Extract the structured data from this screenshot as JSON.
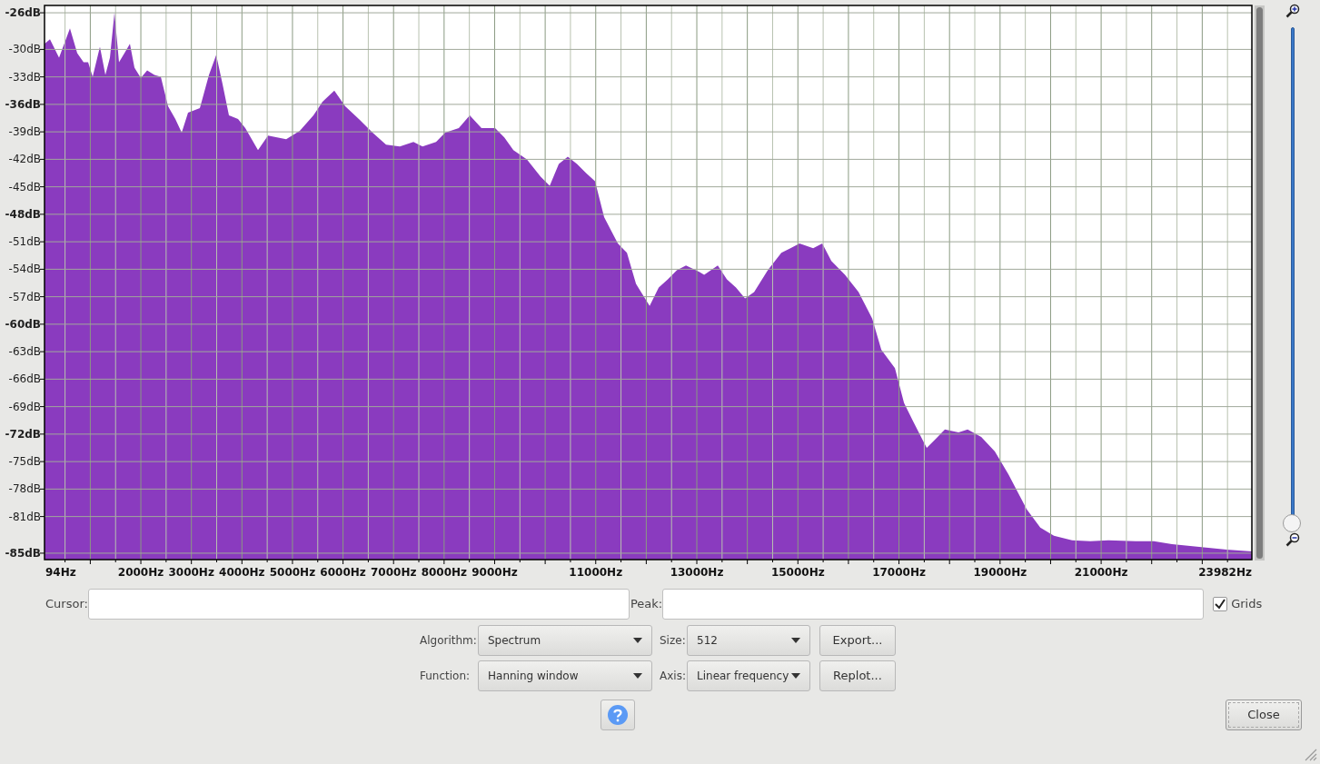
{
  "plot": {
    "chart_data": {
      "type": "area",
      "grid": true,
      "xlim": [
        94,
        23982
      ],
      "ylim": [
        -85.7,
        -25.2
      ],
      "xticks": [
        {
          "value": 94,
          "label": "94Hz"
        },
        {
          "value": 2000,
          "label": "2000Hz"
        },
        {
          "value": 3000,
          "label": "3000Hz"
        },
        {
          "value": 4000,
          "label": "4000Hz"
        },
        {
          "value": 5000,
          "label": "5000Hz"
        },
        {
          "value": 6000,
          "label": "6000Hz"
        },
        {
          "value": 7000,
          "label": "7000Hz"
        },
        {
          "value": 8000,
          "label": "8000Hz"
        },
        {
          "value": 9000,
          "label": "9000Hz"
        },
        {
          "value": 11000,
          "label": "11000Hz"
        },
        {
          "value": 13000,
          "label": "13000Hz"
        },
        {
          "value": 15000,
          "label": "15000Hz"
        },
        {
          "value": 17000,
          "label": "17000Hz"
        },
        {
          "value": 19000,
          "label": "19000Hz"
        },
        {
          "value": 21000,
          "label": "21000Hz"
        },
        {
          "value": 23982,
          "label": "23982Hz"
        }
      ],
      "yticks": [
        {
          "value": -26,
          "label": "-26dB"
        },
        {
          "value": -30,
          "label": "-30dB"
        },
        {
          "value": -33,
          "label": "-33dB"
        },
        {
          "value": -36,
          "label": "-36dB"
        },
        {
          "value": -39,
          "label": "-39dB"
        },
        {
          "value": -42,
          "label": "-42dB"
        },
        {
          "value": -45,
          "label": "-45dB"
        },
        {
          "value": -48,
          "label": "-48dB"
        },
        {
          "value": -51,
          "label": "-51dB"
        },
        {
          "value": -54,
          "label": "-54dB"
        },
        {
          "value": -57,
          "label": "-57dB"
        },
        {
          "value": -60,
          "label": "-60dB"
        },
        {
          "value": -63,
          "label": "-63dB"
        },
        {
          "value": -66,
          "label": "-66dB"
        },
        {
          "value": -69,
          "label": "-69dB"
        },
        {
          "value": -72,
          "label": "-72dB"
        },
        {
          "value": -75,
          "label": "-75dB"
        },
        {
          "value": -78,
          "label": "-78dB"
        },
        {
          "value": -81,
          "label": "-81dB"
        },
        {
          "value": -85,
          "label": "-85dB"
        }
      ],
      "x": [
        94,
        202,
        382,
        597,
        741,
        867,
        957,
        1047,
        1190,
        1298,
        1388,
        1478,
        1568,
        1676,
        1784,
        1874,
        2000,
        2125,
        2269,
        2395,
        2539,
        2683,
        2808,
        2934,
        3168,
        3347,
        3491,
        3617,
        3743,
        3923,
        4067,
        4318,
        4516,
        4696,
        4876,
        5145,
        5415,
        5595,
        5828,
        6044,
        6314,
        6584,
        6853,
        7123,
        7393,
        7573,
        7841,
        8021,
        8291,
        8507,
        8740,
        9010,
        9190,
        9370,
        9639,
        9909,
        10089,
        10269,
        10448,
        10628,
        10808,
        10987,
        11167,
        11437,
        11617,
        11797,
        12066,
        12246,
        12426,
        12605,
        12785,
        13055,
        13145,
        13414,
        13594,
        13774,
        13954,
        14133,
        14403,
        14673,
        14852,
        15032,
        15302,
        15482,
        15661,
        15931,
        16200,
        16470,
        16650,
        16920,
        17100,
        17279,
        17549,
        17729,
        17908,
        18178,
        18358,
        18627,
        18897,
        19167,
        19526,
        19796,
        20065,
        20425,
        20784,
        21144,
        21683,
        22043,
        22402,
        22941,
        23481,
        23982
      ],
      "series": [
        {
          "color": "#8a3bbf",
          "values": [
            -29.4,
            -28.9,
            -30.9,
            -27.7,
            -30.4,
            -31.4,
            -31.4,
            -33.0,
            -29.7,
            -32.8,
            -30.9,
            -26.0,
            -31.4,
            -30.4,
            -29.4,
            -32.0,
            -33.1,
            -32.3,
            -32.8,
            -33.0,
            -36.2,
            -37.6,
            -39.1,
            -36.9,
            -36.4,
            -32.8,
            -30.6,
            -33.8,
            -37.2,
            -37.6,
            -38.6,
            -41.0,
            -39.4,
            -39.6,
            -39.8,
            -38.9,
            -37.2,
            -35.7,
            -34.5,
            -36.2,
            -37.6,
            -39.1,
            -40.4,
            -40.6,
            -40.1,
            -40.6,
            -40.1,
            -39.1,
            -38.6,
            -37.2,
            -38.6,
            -38.6,
            -39.6,
            -41.0,
            -42.0,
            -43.9,
            -44.9,
            -42.5,
            -41.7,
            -42.5,
            -43.5,
            -44.4,
            -48.3,
            -51.2,
            -52.2,
            -55.6,
            -58.0,
            -56.0,
            -55.1,
            -54.1,
            -53.6,
            -54.3,
            -54.6,
            -53.6,
            -55.1,
            -56.0,
            -57.2,
            -56.5,
            -54.1,
            -52.2,
            -51.7,
            -51.2,
            -51.7,
            -51.2,
            -53.1,
            -54.6,
            -56.5,
            -59.4,
            -62.8,
            -64.8,
            -68.6,
            -70.6,
            -73.5,
            -72.5,
            -71.5,
            -71.8,
            -71.5,
            -72.3,
            -73.9,
            -76.4,
            -80.2,
            -82.2,
            -83.1,
            -83.6,
            -83.7,
            -83.6,
            -83.7,
            -83.7,
            -84.0,
            -84.3,
            -84.6,
            -84.8
          ]
        }
      ]
    }
  },
  "zoom": {
    "level": 0
  },
  "cursor": {
    "label": "Cursor:"
  },
  "peak": {
    "label": "Peak:"
  },
  "grids": {
    "label": "Grids",
    "checked": true
  },
  "algorithm": {
    "label": "Algorithm:",
    "value": "Spectrum"
  },
  "size": {
    "label": "Size:",
    "value": "512"
  },
  "export_button": "Export...",
  "function": {
    "label": "Function:",
    "value": "Hanning window"
  },
  "axis": {
    "label": "Axis:",
    "value": "Linear frequency"
  },
  "replot_button": "Replot...",
  "close_button": "Close"
}
